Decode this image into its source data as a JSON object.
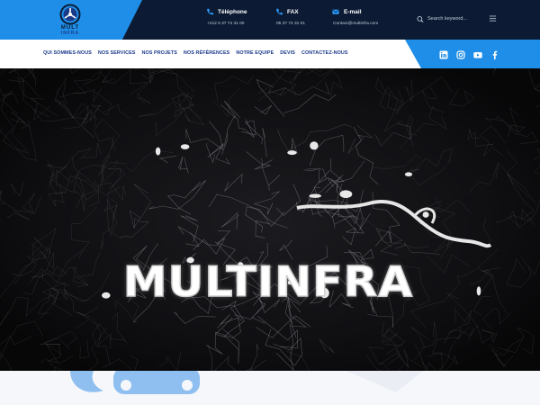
{
  "header": {
    "logo": {
      "icon": "logo-emblem",
      "line1": "MULT",
      "line2": "INFRA"
    },
    "contacts": [
      {
        "icon": "phone-icon",
        "label": "Téléphone",
        "value": "+212 5 37 74 31 00"
      },
      {
        "icon": "fax-icon",
        "label": "FAX",
        "value": "05 37 74 31 01"
      },
      {
        "icon": "mail-icon",
        "label": "E-mail",
        "value": "Contact@multinfra.com"
      }
    ],
    "search": {
      "placeholder": "Search keyword..."
    },
    "colors": {
      "dark": "#0c1b33",
      "accent": "#1f8ee8",
      "nav_text": "#1a3a8a"
    }
  },
  "nav": {
    "items": [
      "QUI SOMMES-NOUS",
      "NOS SERVICES",
      "NOS PROJETS",
      "NOS RÉFÉRENCES",
      "NOTRE EQUIPE",
      "DEVIS",
      "CONTACTEZ-NOUS"
    ],
    "social": [
      "linkedin-icon",
      "instagram-icon",
      "youtube-icon",
      "facebook-icon"
    ]
  },
  "hero": {
    "title": "MULTINFRA"
  }
}
